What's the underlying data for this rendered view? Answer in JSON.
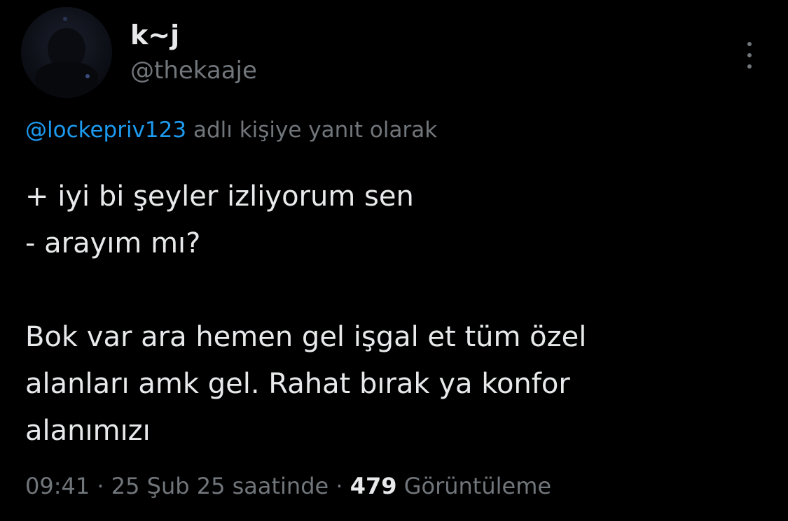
{
  "author": {
    "display_name": "k~j",
    "handle": "@thekaaje",
    "avatar_icon": "avatar-image"
  },
  "reply_context": {
    "mention": "@lockepriv123",
    "suffix": " adlı kişiye yanıt olarak"
  },
  "body": {
    "line1": "+ iyi bi şeyler izliyorum sen",
    "line2": "- arayım mı?",
    "line3": "Bok var ara hemen gel işgal et tüm özel",
    "line4": "alanları amk gel. Rahat bırak ya konfor",
    "line5": "alanımızı"
  },
  "meta": {
    "time": "09:41",
    "sep1": " · ",
    "date": "25 Şub 25 saatinde",
    "sep2": " · ",
    "views_count": "479",
    "views_label": " Görüntüleme"
  },
  "colors": {
    "background": "#000000",
    "text": "#e7e9ea",
    "secondary": "#71767b",
    "link": "#1d9bf0"
  },
  "icons": {
    "more": "more-vertical-icon"
  }
}
